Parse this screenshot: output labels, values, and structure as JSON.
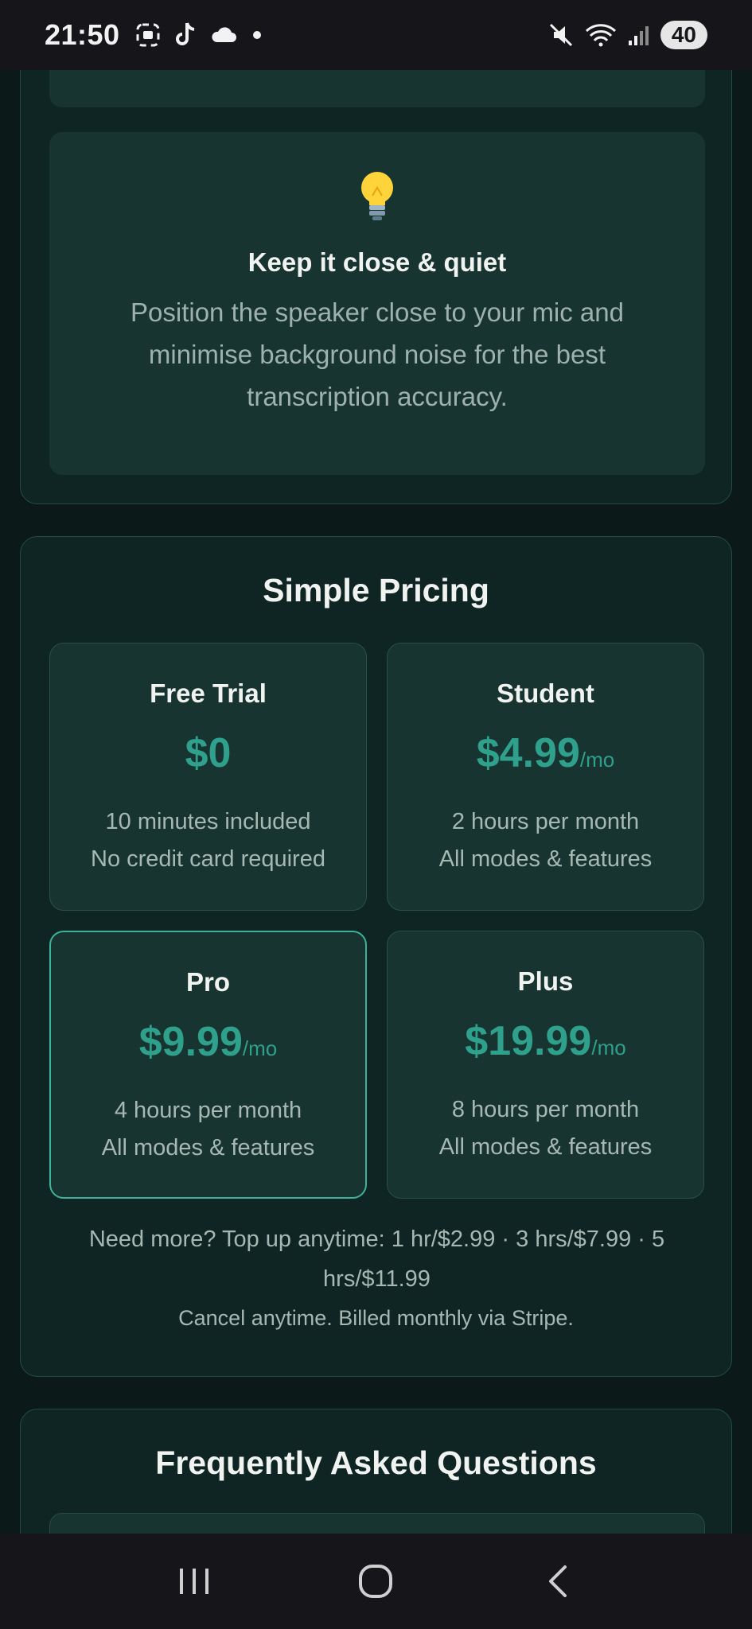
{
  "status_bar": {
    "time": "21:50",
    "battery": "40",
    "icons": [
      "screenshot-icon",
      "tiktok-icon",
      "cloud-icon",
      "dot-icon",
      "mute-icon",
      "wifi-icon",
      "signal-icon"
    ]
  },
  "tip": {
    "icon": "lightbulb-icon",
    "title": "Keep it close & quiet",
    "text": "Position the speaker close to your mic and minimise background noise for the best transcription accuracy."
  },
  "pricing": {
    "title": "Simple Pricing",
    "plans": [
      {
        "name": "Free Trial",
        "price": "$0",
        "period": "",
        "line1": "10 minutes included",
        "line2": "No credit card required"
      },
      {
        "name": "Student",
        "price": "$4.99",
        "period": "/mo",
        "line1": "2 hours per month",
        "line2": "All modes & features"
      },
      {
        "name": "Pro",
        "price": "$9.99",
        "period": "/mo",
        "line1": "4 hours per month",
        "line2": "All modes & features"
      },
      {
        "name": "Plus",
        "price": "$19.99",
        "period": "/mo",
        "line1": "8 hours per month",
        "line2": "All modes & features"
      }
    ],
    "topup": "Need more? Top up anytime: 1 hr/$2.99 · 3 hrs/$7.99 · 5 hrs/$11.99",
    "billing": "Cancel anytime. Billed monthly via Stripe."
  },
  "faq": {
    "title": "Frequently Asked Questions"
  },
  "colors": {
    "background": "#0b1a18",
    "accent": "#2fa08c",
    "highlight_border": "#3fb39a"
  }
}
